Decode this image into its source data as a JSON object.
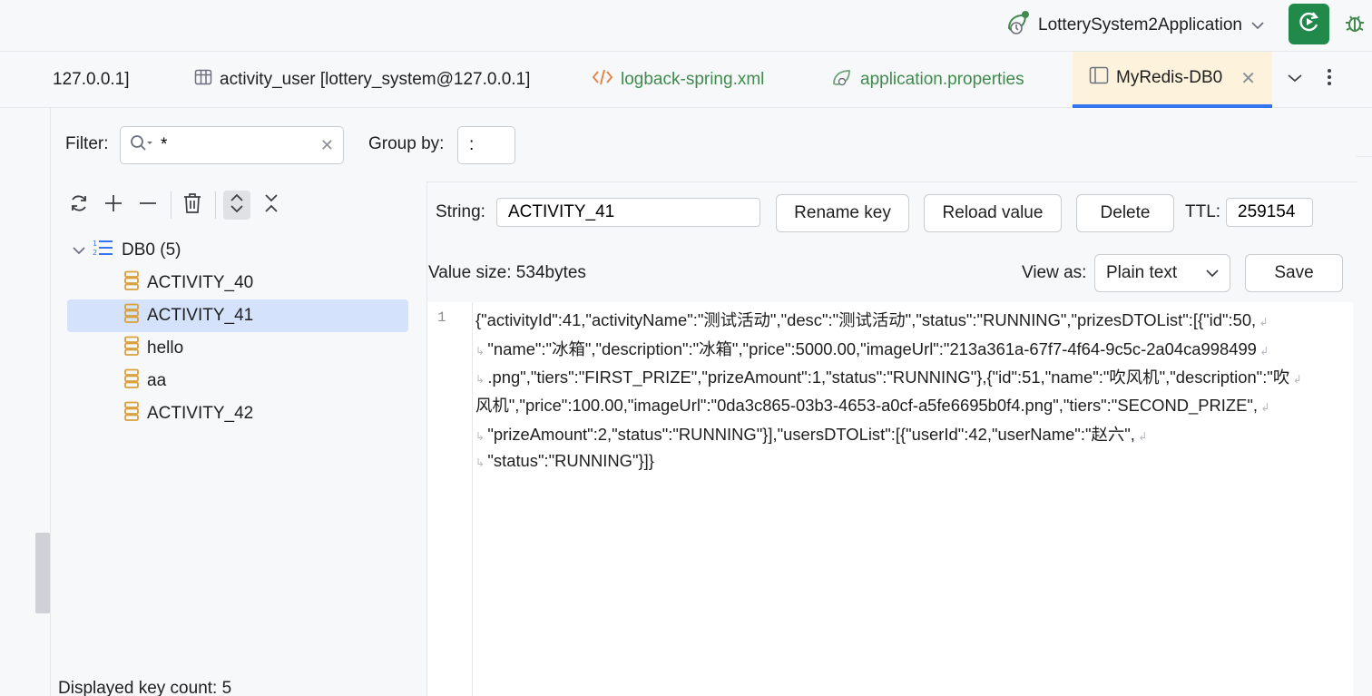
{
  "run_config": {
    "name": "LotterySystem2Application"
  },
  "tabs": [
    {
      "label": "127.0.0.1]"
    },
    {
      "label": "activity_user [lottery_system@127.0.0.1]"
    },
    {
      "label": "logback-spring.xml"
    },
    {
      "label": "application.properties"
    },
    {
      "label": "MyRedis-DB0"
    }
  ],
  "filter": {
    "label": "Filter:",
    "value": "*"
  },
  "group_by": {
    "label": "Group by:",
    "value": ":"
  },
  "tree": {
    "root_label": "DB0 (5)",
    "keys": [
      {
        "label": "ACTIVITY_40"
      },
      {
        "label": "ACTIVITY_41"
      },
      {
        "label": "hello"
      },
      {
        "label": "aa"
      },
      {
        "label": "ACTIVITY_42"
      }
    ],
    "selected_index": 1,
    "count_label": "Displayed key count: 5"
  },
  "editor": {
    "type_label": "String:",
    "key_value": "ACTIVITY_41",
    "rename_label": "Rename key",
    "reload_label": "Reload value",
    "delete_label": "Delete",
    "ttl_label": "TTL:",
    "ttl_value": "259154",
    "value_size": "Value size: 534bytes",
    "view_as_label": "View as:",
    "view_as_value": "Plain text",
    "save_label": "Save",
    "line_number": "1",
    "lines": [
      "{\"activityId\":41,\"activityName\":\"测试活动\",\"desc\":\"测试活动\",\"status\":\"RUNNING\",\"prizesDTOList\":[{\"id\":50,",
      "\"name\":\"冰箱\",\"description\":\"冰箱\",\"price\":5000.00,\"imageUrl\":\"213a361a-67f7-4f64-9c5c-2a04ca998499",
      ".png\",\"tiers\":\"FIRST_PRIZE\",\"prizeAmount\":1,\"status\":\"RUNNING\"},{\"id\":51,\"name\":\"吹风机\",\"description\":\"吹",
      "风机\",\"price\":100.00,\"imageUrl\":\"0da3c865-03b3-4653-a0cf-a5fe6695b0f4.png\",\"tiers\":\"SECOND_PRIZE\",",
      "\"prizeAmount\":2,\"status\":\"RUNNING\"}],\"usersDTOList\":[{\"userId\":42,\"userName\":\"赵六\",",
      "\"status\":\"RUNNING\"}]}"
    ]
  },
  "colors": {
    "accent": "#3574f0",
    "run_green": "#21894a",
    "selection": "#d4e2fc",
    "key_icon": "#d9a03c",
    "green_text": "#3f8a4c"
  }
}
